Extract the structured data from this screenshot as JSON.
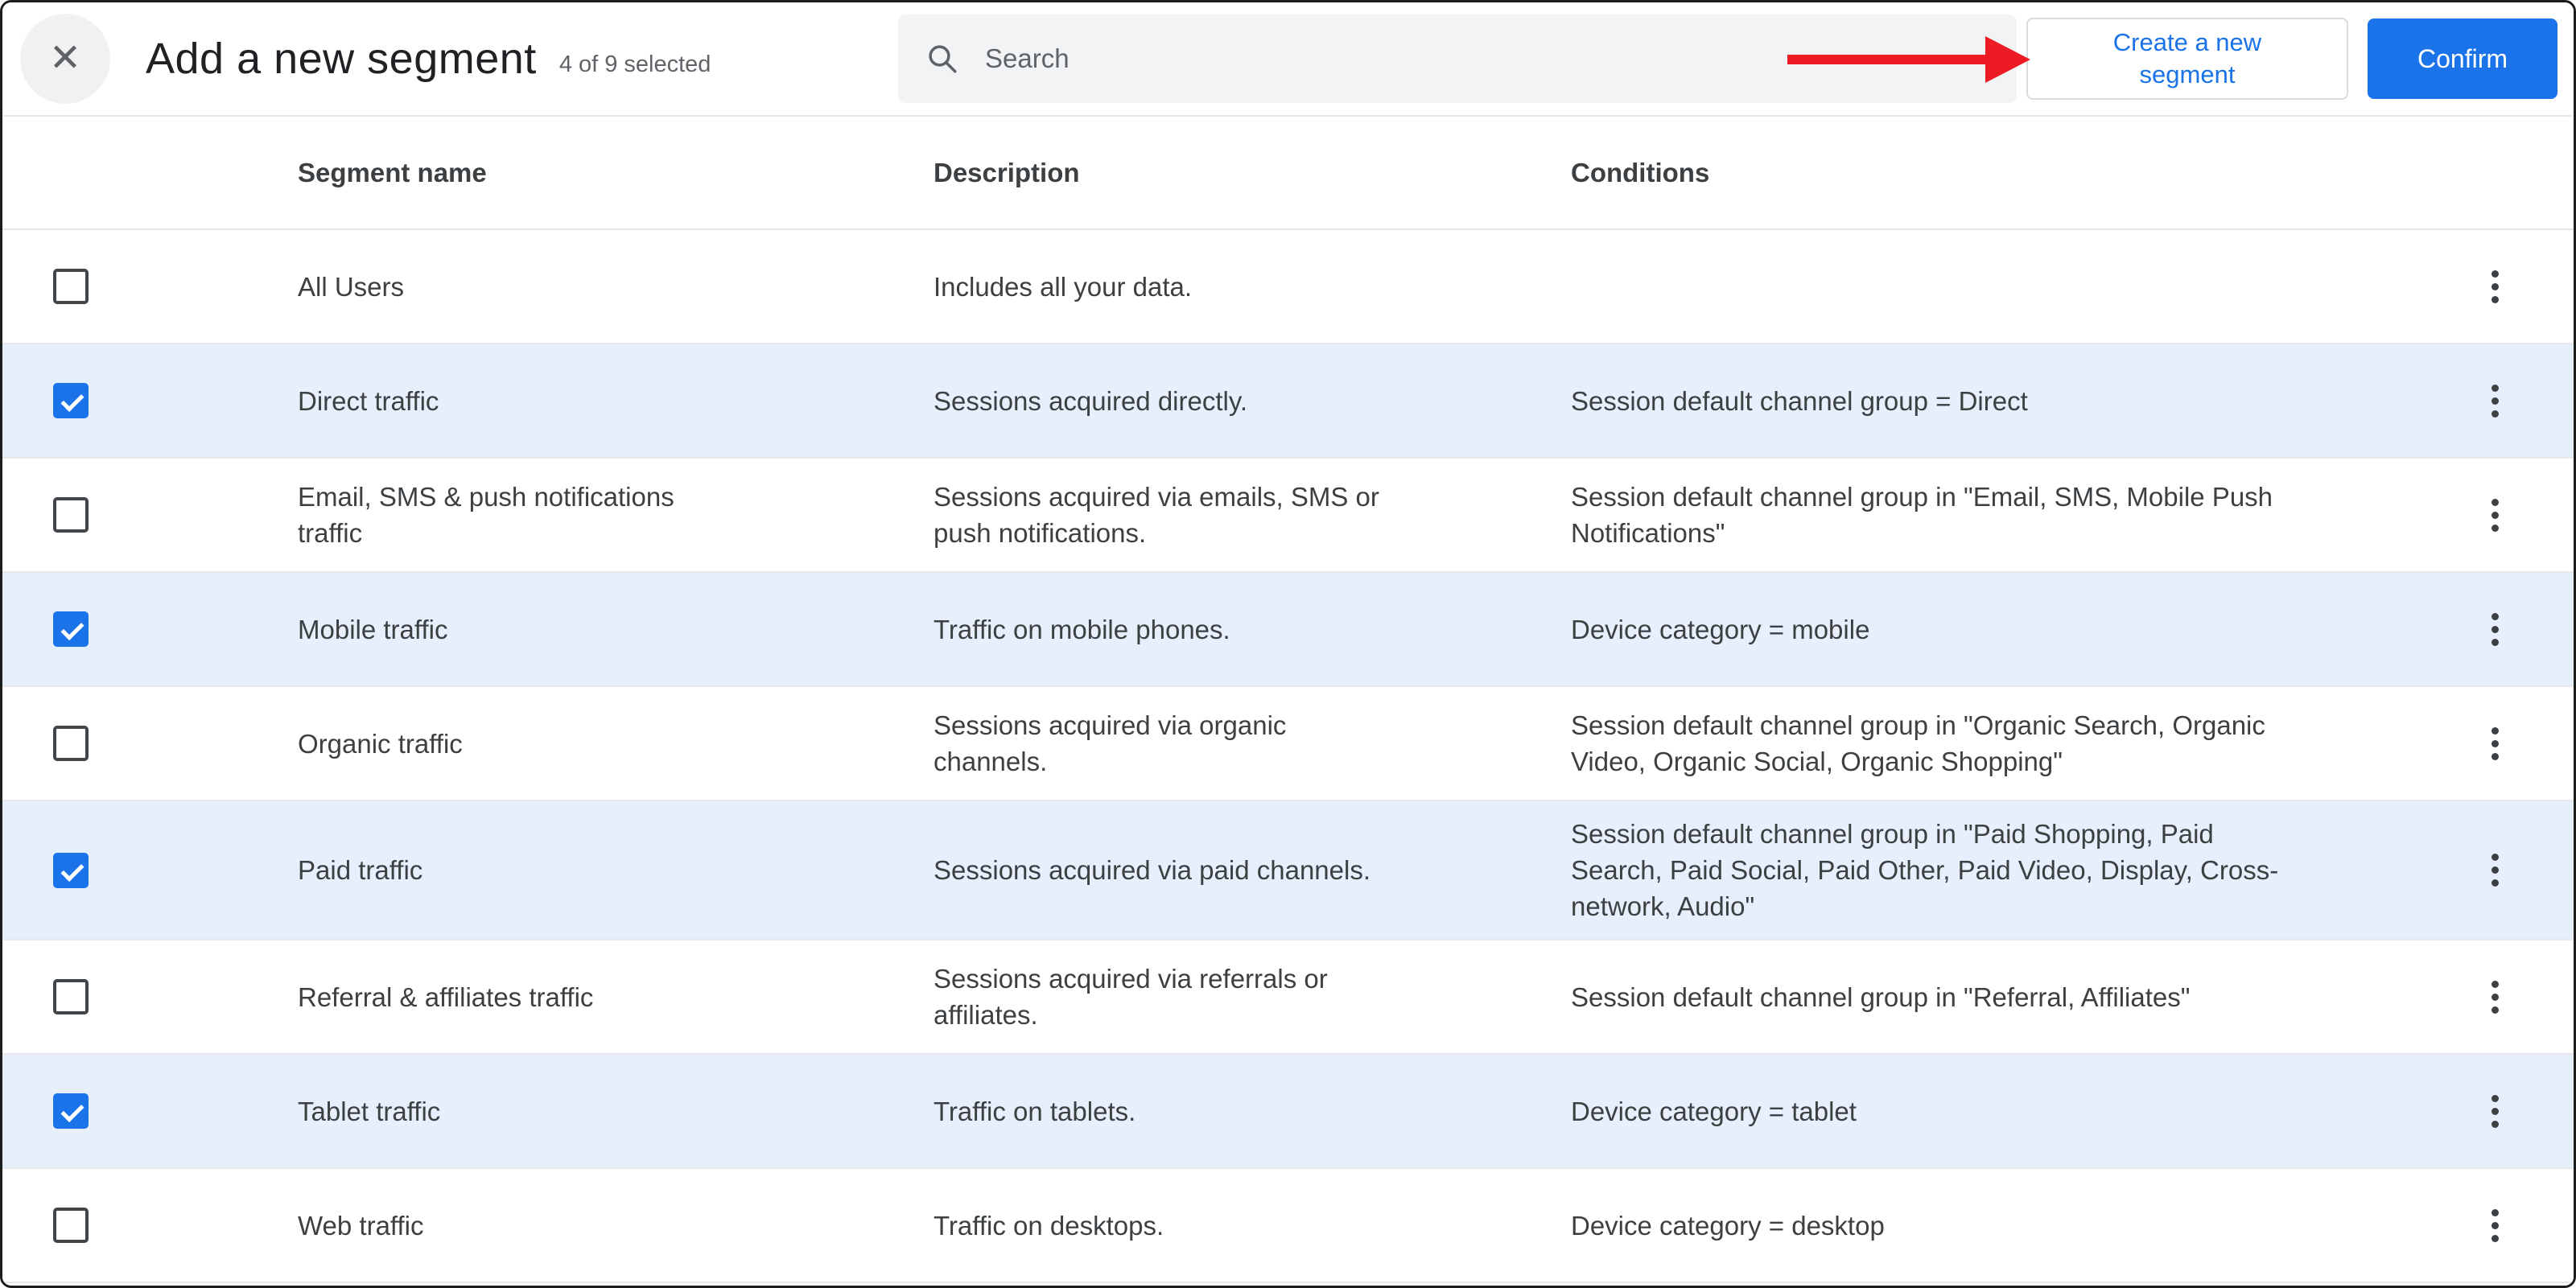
{
  "window": {
    "title": "Add a new segment",
    "selection_status": "4 of 9 selected"
  },
  "header": {
    "search_placeholder": "Search",
    "create_button_label": "Create a new segment",
    "confirm_button_label": "Confirm"
  },
  "icons": {
    "close": "✕",
    "search": "magnifying-glass",
    "kebab": "vertical-three-dots"
  },
  "table": {
    "columns": {
      "segment_name": "Segment name",
      "description": "Description",
      "conditions": "Conditions"
    },
    "rows": [
      {
        "name": "All Users",
        "description": "Includes all your data.",
        "conditions": "",
        "checked": false
      },
      {
        "name": "Direct traffic",
        "description": "Sessions acquired directly.",
        "conditions": "Session default channel group = Direct",
        "checked": true
      },
      {
        "name": "Email, SMS & push notifications traffic",
        "description": "Sessions acquired via emails, SMS or push notifications.",
        "conditions": "Session default channel group in \"Email, SMS, Mobile Push Notifications\"",
        "checked": false
      },
      {
        "name": "Mobile traffic",
        "description": "Traffic on mobile phones.",
        "conditions": "Device category = mobile",
        "checked": true
      },
      {
        "name": "Organic traffic",
        "description": "Sessions acquired via organic channels.",
        "conditions": "Session default channel group in \"Organic Search, Organic Video, Organic Social, Organic Shopping\"",
        "checked": false
      },
      {
        "name": "Paid traffic",
        "description": "Sessions acquired via paid channels.",
        "conditions": "Session default channel group in \"Paid Shopping, Paid Search, Paid Social, Paid Other, Paid Video, Display, Cross-network, Audio\"",
        "checked": true
      },
      {
        "name": "Referral & affiliates traffic",
        "description": "Sessions acquired via referrals or affiliates.",
        "conditions": "Session default channel group in \"Referral, Affiliates\"",
        "checked": false
      },
      {
        "name": "Tablet traffic",
        "description": "Traffic on tablets.",
        "conditions": "Device category = tablet",
        "checked": true
      },
      {
        "name": "Web traffic",
        "description": "Traffic on desktops.",
        "conditions": "Device category = desktop",
        "checked": false
      }
    ]
  },
  "colors": {
    "accent_blue": "#1a73e8",
    "selected_row_bg": "#e7effc",
    "annotation_arrow_red": "#ed1c24"
  }
}
